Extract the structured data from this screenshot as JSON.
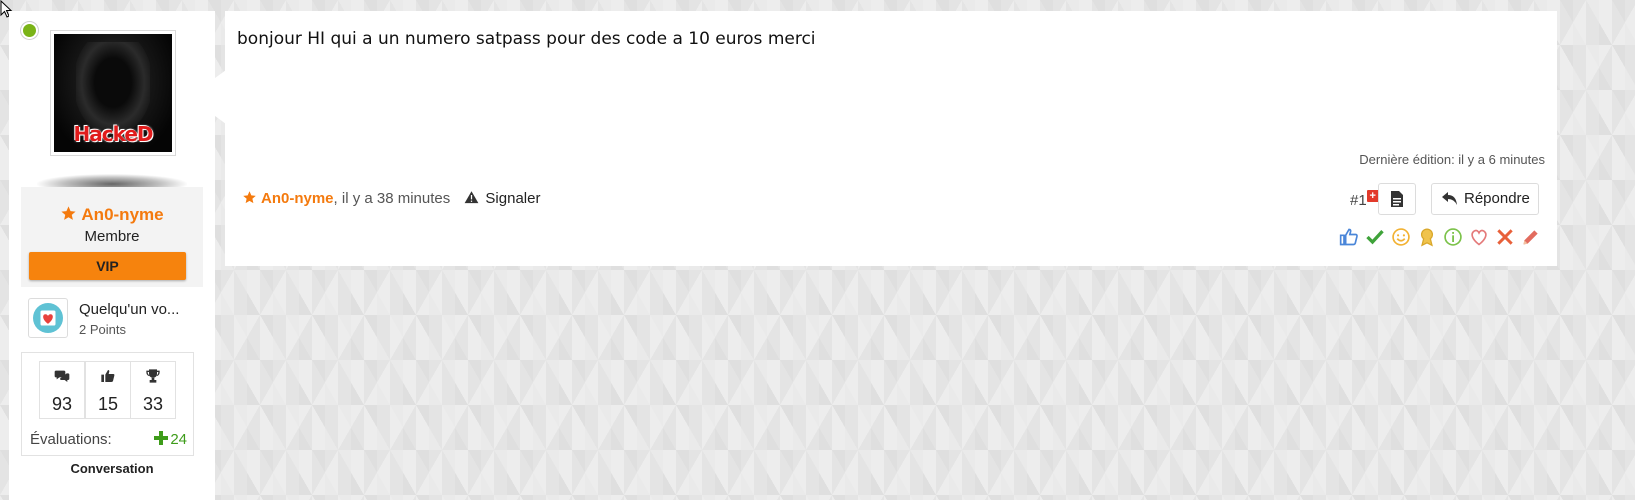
{
  "author": {
    "name": "An0-nyme",
    "rank": "Membre",
    "vip_label": "VIP",
    "avatar_text": "HackeD",
    "online": true
  },
  "award": {
    "name": "Quelqu'un vo...",
    "points": "2 Points"
  },
  "stats": {
    "messages": "93",
    "likes": "15",
    "trophies": "33",
    "evaluations_label": "Évaluations:",
    "evaluations_value": "24",
    "conversation_label": "Conversation"
  },
  "post": {
    "body": "bonjour HI qui a un numero satpass pour des code a 10 euros merci",
    "last_edit": "Dernière édition: il y a 6 minutes",
    "author": "An0-nyme",
    "time": ", il y a 38 minutes",
    "report_label": "Signaler",
    "number": "#1",
    "reply_label": "Répondre"
  },
  "reactions": [
    "thumbs-up-icon",
    "check-icon",
    "smile-icon",
    "award-icon",
    "info-icon",
    "heart-icon",
    "cross-icon",
    "pencil-icon"
  ],
  "colors": {
    "accent": "#f47a0e",
    "vip": "#f6830d",
    "online": "#7ab317",
    "positive": "#3e9c1a"
  }
}
